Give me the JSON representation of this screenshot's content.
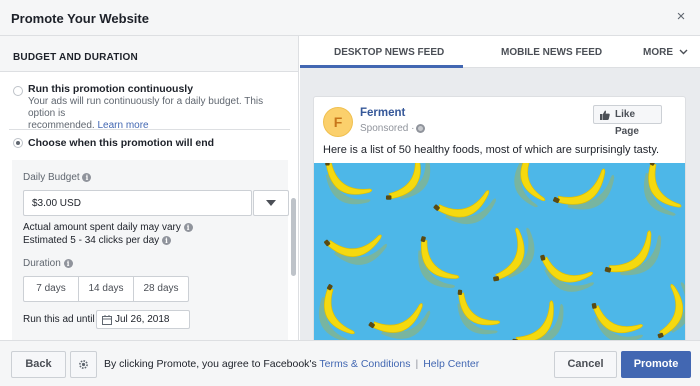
{
  "dialog": {
    "title": "Promote Your Website",
    "close_glyph": "×"
  },
  "budget": {
    "section_title": "BUDGET AND DURATION",
    "continuous": {
      "title": "Run this promotion continuously",
      "description_1": "Your ads will run continuously for a daily budget. This option is",
      "description_2": "recommended. ",
      "learn_more": "Learn more",
      "selected": false
    },
    "end_date_option": {
      "title": "Choose when this promotion will end",
      "selected": true
    },
    "daily_budget_label": "Daily Budget",
    "daily_budget_value": "$3.00 USD",
    "actual_spent_note": "Actual amount spent daily may vary",
    "estimate_note": "Estimated 5 - 34 clicks per day",
    "duration_label": "Duration",
    "durations": [
      "7 days",
      "14 days",
      "28 days"
    ],
    "run_until_label": "Run this ad until",
    "run_until_date": "Jul 26, 2018",
    "info_glyph": "i"
  },
  "preview": {
    "tabs": [
      "DESKTOP NEWS FEED",
      "MOBILE NEWS FEED",
      "MORE"
    ],
    "active_tab": 0,
    "page_initial": "F",
    "page_name": "Ferment",
    "sponsored_label": "Sponsored ·",
    "like_button": "Like Page",
    "post_text": "Here is a list of 50 healthy foods, most of which are surprisingly tasty.",
    "image_background": "#4db7e8"
  },
  "footer": {
    "back_label": "Back",
    "legal_prefix": "By clicking Promote, you agree to Facebook's ",
    "terms_link": "Terms & Conditions",
    "separator": "|",
    "help_link": "Help Center",
    "cancel_label": "Cancel",
    "promote_label": "Promote"
  },
  "colors": {
    "accent": "#4267b2",
    "link": "#365899",
    "background": "#f5f6f7"
  }
}
